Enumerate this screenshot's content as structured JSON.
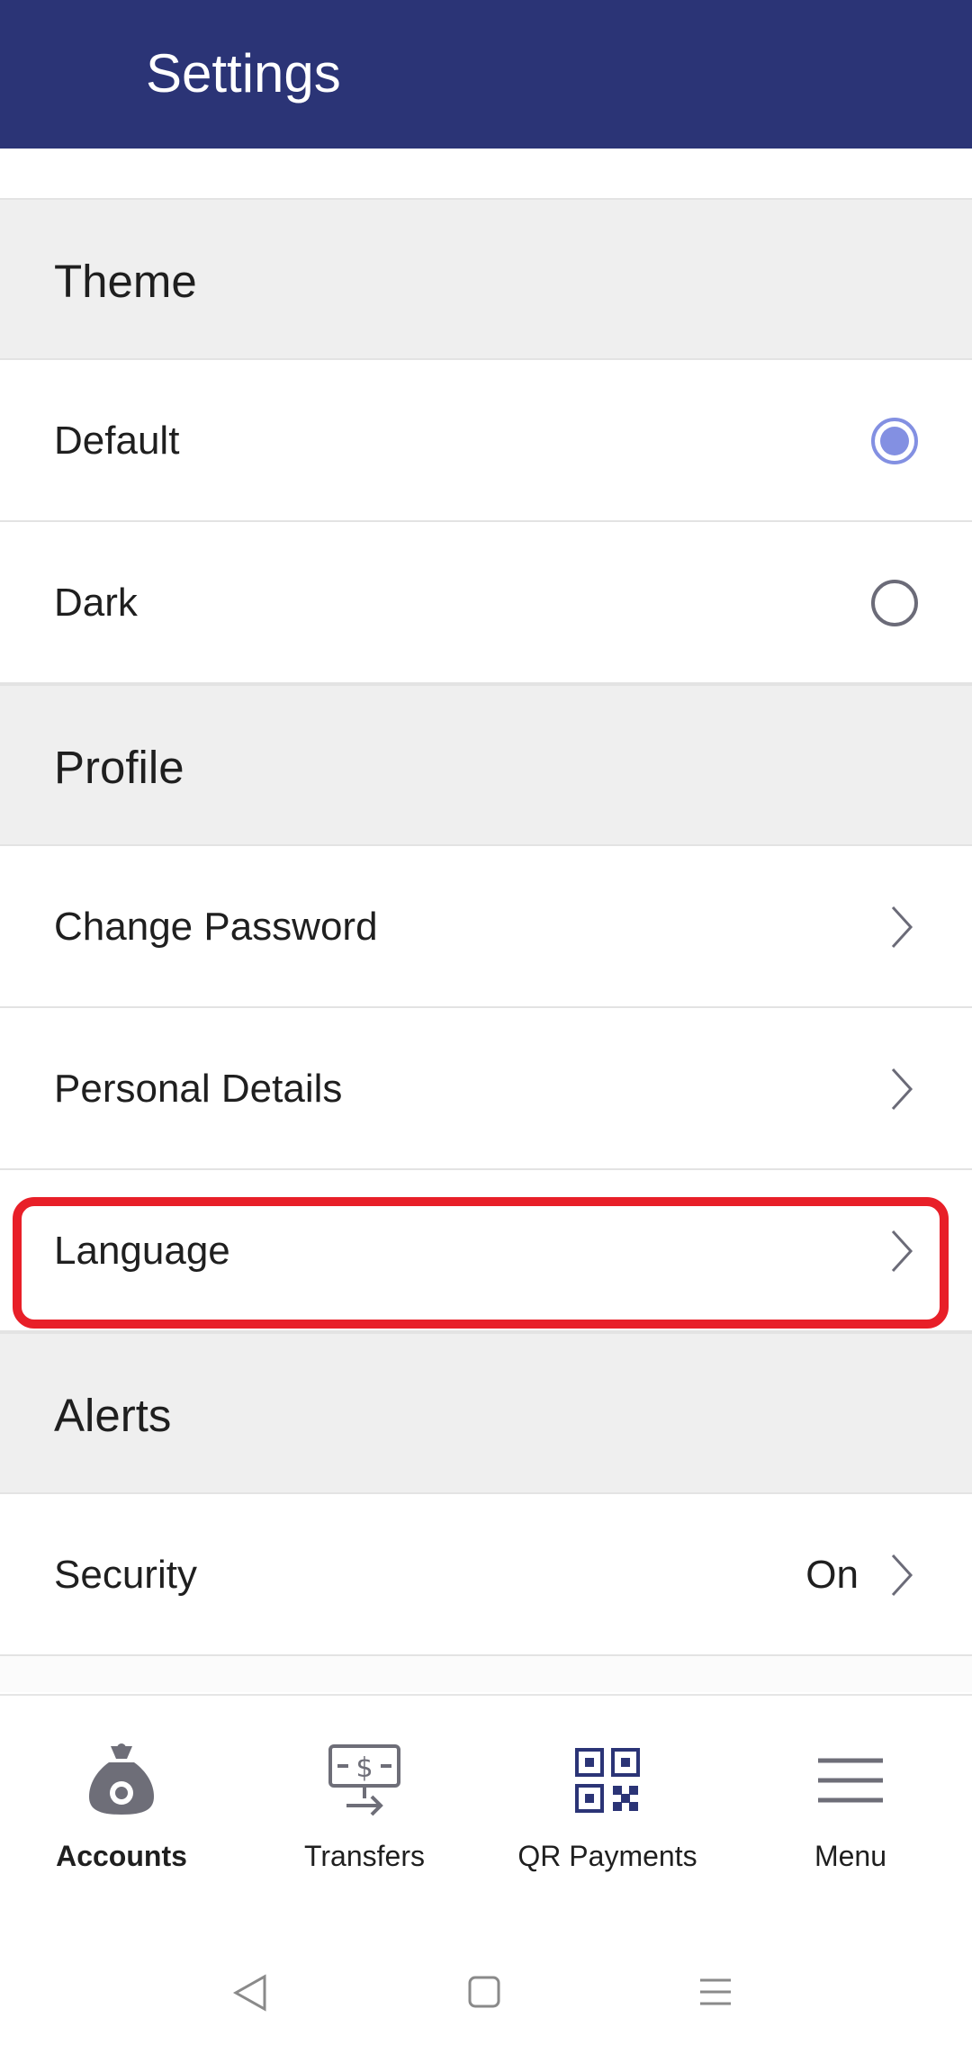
{
  "header": {
    "title": "Settings"
  },
  "sections": {
    "theme": {
      "title": "Theme",
      "options": [
        {
          "label": "Default",
          "selected": true
        },
        {
          "label": "Dark",
          "selected": false
        }
      ]
    },
    "profile": {
      "title": "Profile",
      "items": [
        {
          "label": "Change Password"
        },
        {
          "label": "Personal Details"
        },
        {
          "label": "Language"
        }
      ]
    },
    "alerts": {
      "title": "Alerts",
      "items": [
        {
          "label": "Security",
          "value": "On"
        }
      ]
    }
  },
  "bottom_nav": {
    "items": [
      {
        "label": "Accounts",
        "icon": "money-bag-icon",
        "active": true
      },
      {
        "label": "Transfers",
        "icon": "transfer-icon",
        "active": false
      },
      {
        "label": "QR Payments",
        "icon": "qr-code-icon",
        "active": false
      },
      {
        "label": "Menu",
        "icon": "hamburger-menu-icon",
        "active": false
      }
    ]
  },
  "colors": {
    "header_bg": "#2b3476",
    "accent": "#8390e2",
    "highlight": "#e81f28",
    "section_bg": "#efefef"
  }
}
